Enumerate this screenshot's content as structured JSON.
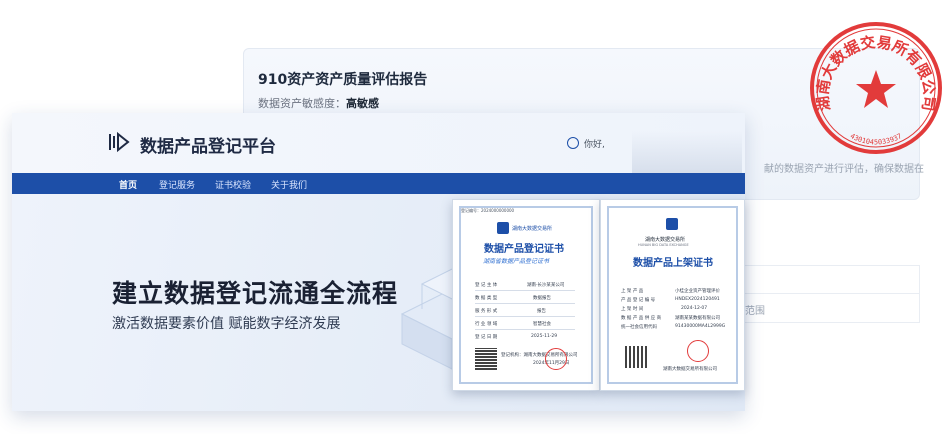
{
  "report": {
    "title": "910资产资产质量评估报告",
    "sensitivity_label": "数据资产敏感度：",
    "sensitivity_value": "高敏感",
    "description": "献的数据资产进行评估，确保数据在",
    "faint_text": "范围"
  },
  "platform": {
    "brand": "数据产品登记平台",
    "user_name": "你好,",
    "nav": [
      "首页",
      "登记服务",
      "证书校验",
      "关于我们"
    ],
    "hero_title": "建立数据登记流通全流程",
    "hero_subtitle": "激活数据要素价值 赋能数字经济发展"
  },
  "certificate_registration": {
    "top_no": "登记编号：2024000000000",
    "org": "湖南大数据交易所",
    "title": "数据产品登记证书",
    "subtitle": "湖南省数据产品登记证书",
    "fields": [
      {
        "label": "登 记 主 体",
        "value": "湖南·长沙某某公司"
      },
      {
        "label": "数 据 类 型",
        "value": "数据报告"
      },
      {
        "label": "服 务 形 式",
        "value": "报告"
      },
      {
        "label": "行 业 领 域",
        "value": "智慧社会"
      },
      {
        "label": "登 记 日 期",
        "value": "2025-11-29"
      }
    ],
    "footer": "登记机构：湖南大数据交易所有限公司",
    "footer_date": "2024年11月29日"
  },
  "certificate_listing": {
    "org": "湖南大数据交易所",
    "org_en": "HUNAN BIG DATA EXCHANGE",
    "title": "数据产品上架证书",
    "fields": [
      {
        "label": "上 架 产 品",
        "value": "小桂企业资产管理评价"
      },
      {
        "label": "产 品 登 记 编 号",
        "value": "HNDEX2024120491"
      },
      {
        "label": "上 架 时 间",
        "value": "2024-12-07"
      },
      {
        "label": "数 据 产 品 供 应 商",
        "value": "湖南某某数据有限公司"
      },
      {
        "label": "统一社会信用代码",
        "value": "91430000MA4L2999G"
      }
    ],
    "footer": "湖南大数据交易所有限公司"
  },
  "seal": {
    "text": "湖南大数据交易所有限公司",
    "code": "4301045033937"
  },
  "colors": {
    "nav_blue": "#1d4fa8",
    "seal_red": "#e23b3b"
  }
}
